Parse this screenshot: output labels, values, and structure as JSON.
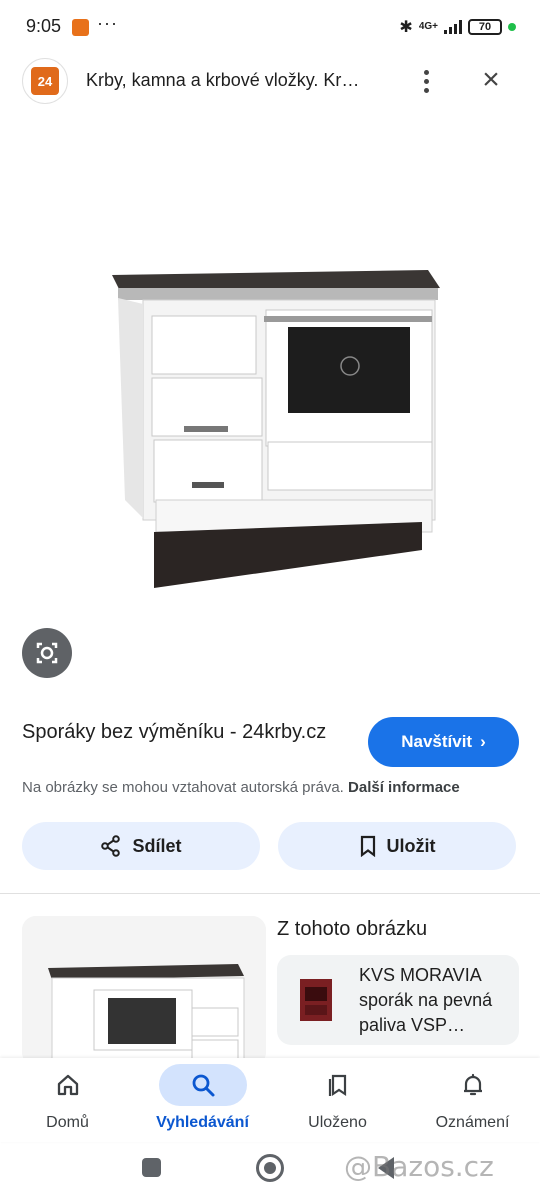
{
  "status_bar": {
    "time": "9:05",
    "more": "···",
    "network": "4G+",
    "battery": "70"
  },
  "header": {
    "site_logo_text": "24",
    "title": "Krby, kamna a krbové vložky. Kr…"
  },
  "result": {
    "title": "Sporáky bez výměníku - 24krby.cz",
    "visit_label": "Navštívit",
    "copyright_text": "Na obrázky se mohou vztahovat autorská práva.",
    "copyright_link": "Další informace"
  },
  "actions": {
    "share_label": "Sdílet",
    "save_label": "Uložit"
  },
  "related": {
    "heading": "Z tohoto obrázku",
    "card_text": "KVS MORAVIA sporák na pevná paliva VSP…"
  },
  "bottom_nav": {
    "items": [
      {
        "label": "Domů",
        "icon": "home-icon",
        "active": false
      },
      {
        "label": "Vyhledávání",
        "icon": "search-icon",
        "active": true
      },
      {
        "label": "Uloženo",
        "icon": "saved-icon",
        "active": false
      },
      {
        "label": "Oznámení",
        "icon": "bell-icon",
        "active": false
      }
    ]
  },
  "watermark": "@Bazos.cz",
  "colors": {
    "accent": "#1a73e8",
    "chip_bg": "#e8f0fe",
    "nav_active": "#d3e3fd",
    "nav_active_text": "#0b57d0"
  }
}
